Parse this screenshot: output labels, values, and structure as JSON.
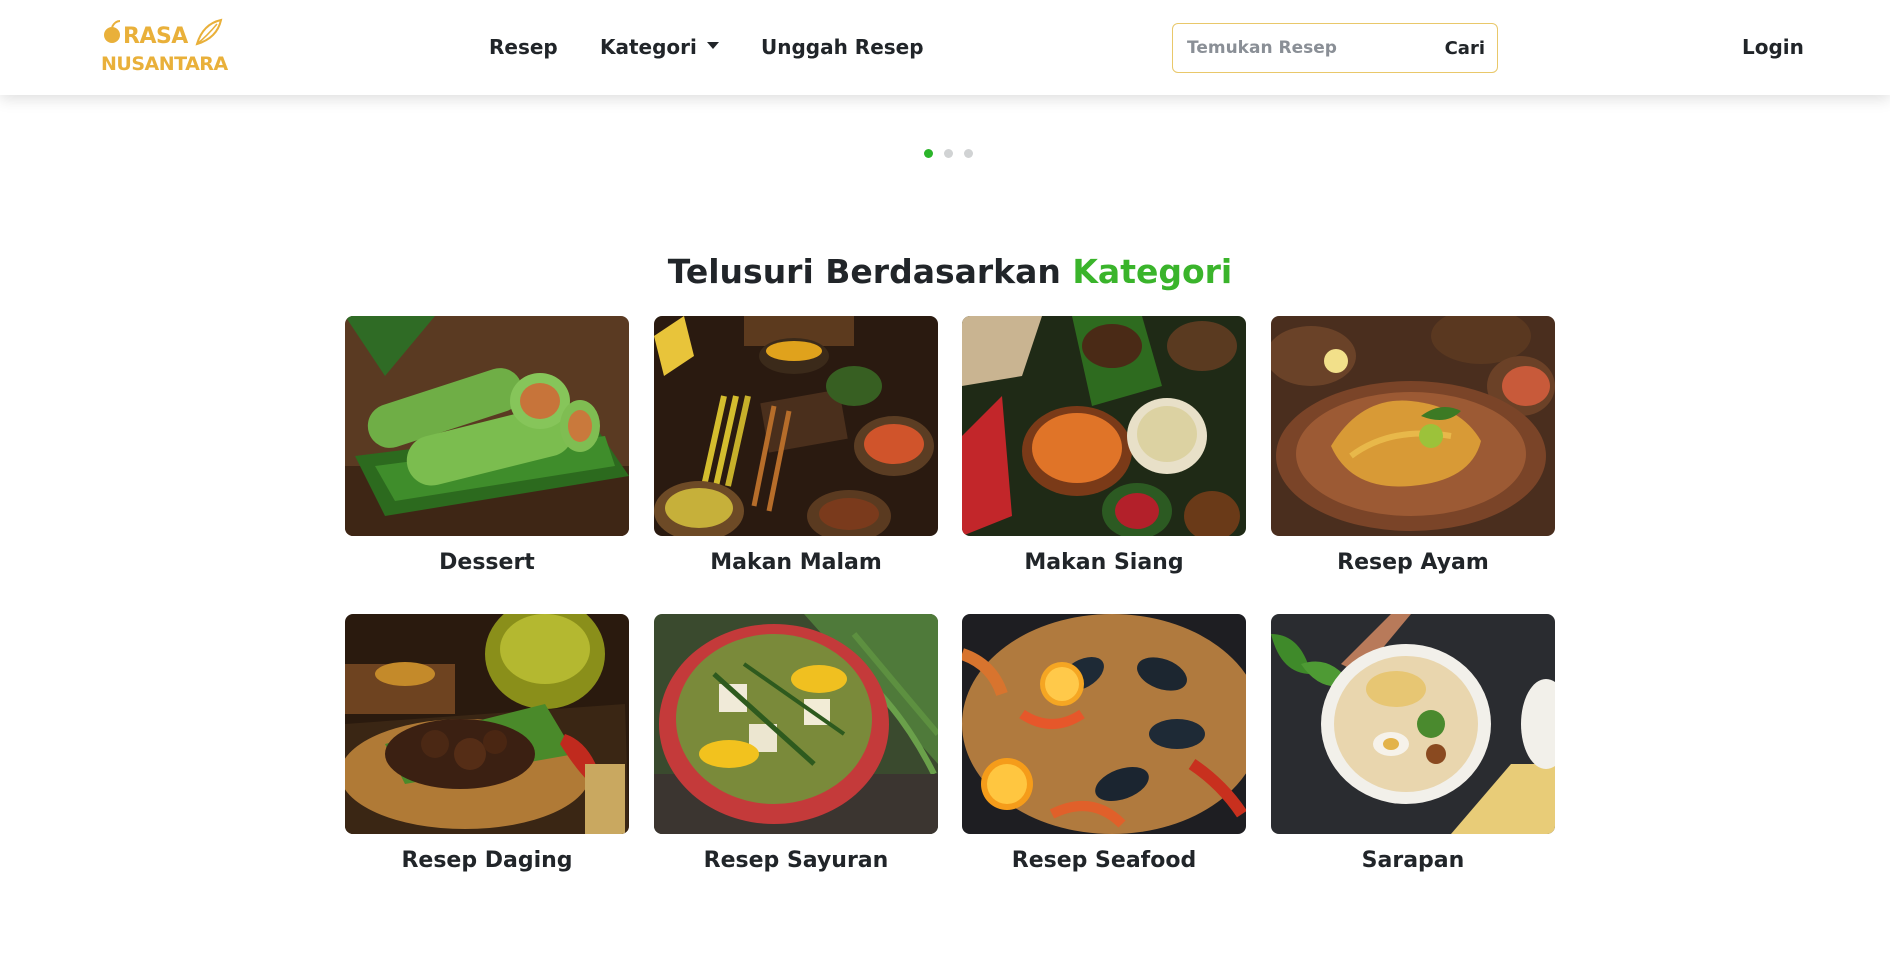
{
  "brand": {
    "line1": "RASA",
    "line2": "NUSANTARA",
    "color": "#e9b03a"
  },
  "nav": {
    "items": [
      {
        "label": "Resep"
      },
      {
        "label": "Kategori",
        "has_dropdown": true
      },
      {
        "label": "Unggah Resep"
      }
    ],
    "login_label": "Login"
  },
  "search": {
    "placeholder": "Temukan Resep",
    "value": "",
    "button_label": "Cari"
  },
  "carousel": {
    "slides": 3,
    "active": 0,
    "active_color": "#2bb52a"
  },
  "category_section": {
    "title_main": "Telusuri Berdasarkan",
    "title_accent": "Kategori",
    "accent_color": "#3ab42b",
    "categories": [
      {
        "label": "Dessert",
        "image": "green-crepe-rolls-photo"
      },
      {
        "label": "Makan Malam",
        "image": "dinner-spread-photo"
      },
      {
        "label": "Makan Siang",
        "image": "lunch-spread-photo"
      },
      {
        "label": "Resep Ayam",
        "image": "chicken-dish-photo"
      },
      {
        "label": "Resep Daging",
        "image": "beef-rendang-photo"
      },
      {
        "label": "Resep Sayuran",
        "image": "vegetable-soup-photo"
      },
      {
        "label": "Resep Seafood",
        "image": "seafood-platter-photo"
      },
      {
        "label": "Sarapan",
        "image": "breakfast-bowl-photo"
      }
    ]
  }
}
